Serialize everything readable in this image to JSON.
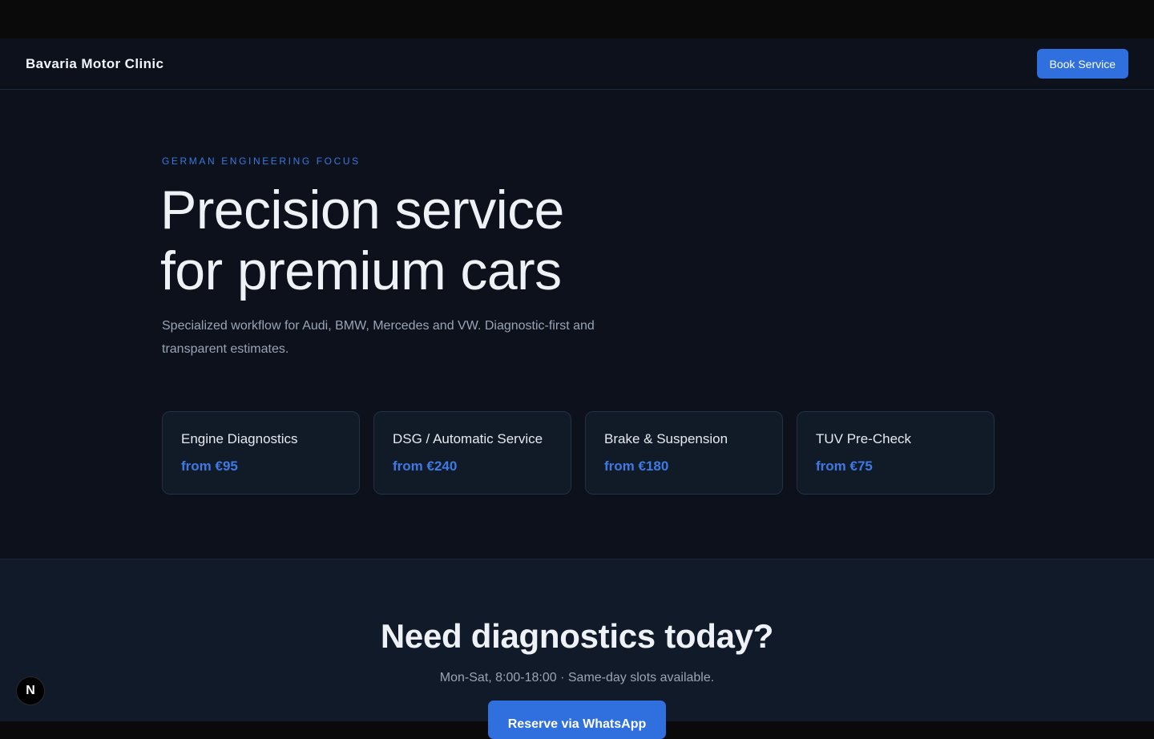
{
  "header": {
    "brand": "Bavaria Motor Clinic",
    "book_label": "Book Service"
  },
  "hero": {
    "eyebrow": "GERMAN ENGINEERING FOCUS",
    "title_line1": "Precision service",
    "title_line2": "for premium cars",
    "subtitle": "Specialized workflow for Audi, BMW, Mercedes and VW. Diagnostic-first and transparent estimates."
  },
  "services": [
    {
      "title": "Engine Diagnostics",
      "price": "from €95"
    },
    {
      "title": "DSG / Automatic Service",
      "price": "from €240"
    },
    {
      "title": "Brake & Suspension",
      "price": "from €180"
    },
    {
      "title": "TUV Pre-Check",
      "price": "from €75"
    }
  ],
  "cta": {
    "title": "Need diagnostics today?",
    "subtitle": "Mon-Sat, 8:00-18:00 · Same-day slots available.",
    "button_label": "Reserve via WhatsApp"
  },
  "badge": {
    "letter": "N"
  },
  "colors": {
    "accent": "#2f6fde",
    "background": "#0c111b",
    "card": "#111a27"
  }
}
